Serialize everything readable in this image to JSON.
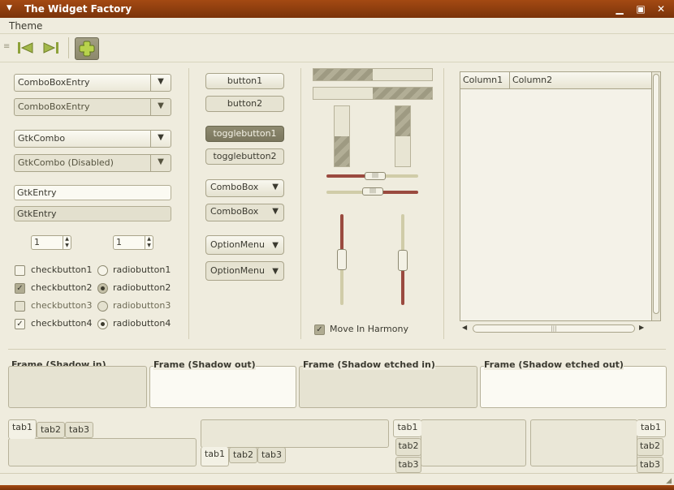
{
  "window": {
    "title": "The Widget Factory"
  },
  "menubar": {
    "theme": "Theme"
  },
  "left": {
    "combo_entry_1": "ComboBoxEntry",
    "combo_entry_2": "ComboBoxEntry",
    "gtkcombo": "GtkCombo",
    "gtkcombo_disabled": "GtkCombo (Disabled)",
    "entry_1": "GtkEntry",
    "entry_2": "GtkEntry",
    "spin_1": "1",
    "spin_2": "1",
    "checks": [
      {
        "label": "checkbutton1",
        "state": "off",
        "mark": ""
      },
      {
        "label": "checkbutton2",
        "state": "on",
        "mark": "✓"
      },
      {
        "label": "checkbutton3",
        "state": "off",
        "mark": ""
      },
      {
        "label": "checkbutton4",
        "state": "on",
        "mark": "✓"
      }
    ],
    "radios": [
      {
        "label": "radiobutton1",
        "selected": false
      },
      {
        "label": "radiobutton2",
        "selected": true
      },
      {
        "label": "radiobutton3",
        "selected": false
      },
      {
        "label": "radiobutton4",
        "selected": true
      }
    ]
  },
  "middle": {
    "button1": "button1",
    "button2": "button2",
    "toggle1": "togglebutton1",
    "toggle2": "togglebutton2",
    "combobox1": "ComboBox",
    "combobox2": "ComboBox",
    "optionmenu1": "OptionMenu",
    "optionmenu2": "OptionMenu"
  },
  "progress": {
    "h1": 0.5,
    "h2": 0.5,
    "v1": 0.5,
    "v2": 0.5
  },
  "scales": {
    "h1": 0.4,
    "h2": 0.4,
    "v1": 0.5,
    "v2": 0.5
  },
  "harmony": {
    "label": "Move In Harmony",
    "mark": "✓"
  },
  "tree": {
    "col1": "Column1",
    "col2": "Column2"
  },
  "frames": [
    {
      "label": "Frame (Shadow in)"
    },
    {
      "label": "Frame (Shadow out)"
    },
    {
      "label": "Frame (Shadow etched in)"
    },
    {
      "label": "Frame (Shadow etched out)"
    }
  ],
  "notebooks": {
    "tabs": [
      "tab1",
      "tab2",
      "tab3"
    ]
  },
  "colors": {
    "accent": "#8c331c",
    "title_bar": "#a44a13",
    "base": "#efecde"
  }
}
